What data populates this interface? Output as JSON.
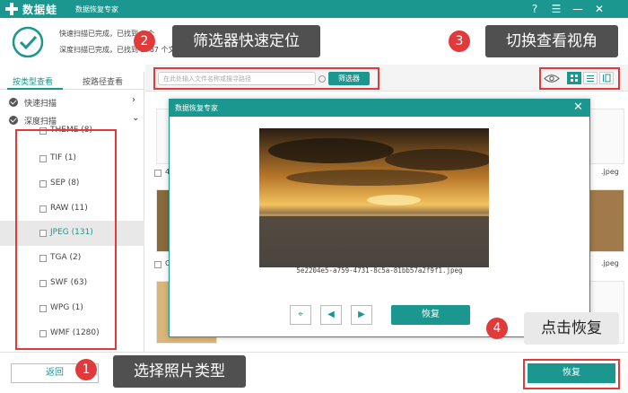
{
  "titlebar": {
    "app_name": "数据蛙",
    "subtitle": "数据恢复专家",
    "help": "?",
    "menu": "☰",
    "minimize": "—",
    "close": "✕"
  },
  "status": {
    "line1": "快速扫描已完成，已找到 3 个",
    "line2": "深度扫描已完成，已找到 3767 个文件 (61.6 GB)"
  },
  "sidebar": {
    "tab_type": "按类型查看",
    "tab_path": "按路径查看",
    "quick_scan": "快速扫描",
    "deep_scan": "深度扫描",
    "items": [
      {
        "label": "THEME (8)"
      },
      {
        "label": "TIF (1)"
      },
      {
        "label": "SEP (8)"
      },
      {
        "label": "RAW (11)"
      },
      {
        "label": "JPEG (131)"
      },
      {
        "label": "TGA (2)"
      },
      {
        "label": "SWF (63)"
      },
      {
        "label": "WPG (1)"
      },
      {
        "label": "WMF (1280)"
      }
    ]
  },
  "toolbar": {
    "search_placeholder": "在此处输入文件名称或搜寻路径",
    "filter_label": "筛选器"
  },
  "content": {
    "labels": [
      ".jpeg",
      ".jpeg",
      "4",
      "C"
    ]
  },
  "dialog": {
    "title": "数据恢复专家",
    "close": "✕",
    "filename": "5e2204e5-a759-4731-8c5a-81bb57a2f9f1.jpeg",
    "restore_label": "恢复"
  },
  "bottom": {
    "back_label": "返回",
    "restore_label": "恢复"
  },
  "annotations": [
    {
      "num": "1",
      "text": "选择照片类型"
    },
    {
      "num": "2",
      "text": "筛选器快速定位"
    },
    {
      "num": "3",
      "text": "切换查看视角"
    },
    {
      "num": "4",
      "text": "点击恢复"
    }
  ],
  "colors": {
    "accent": "#1b978f",
    "highlight": "#e03a3a",
    "callout": "#505050"
  }
}
